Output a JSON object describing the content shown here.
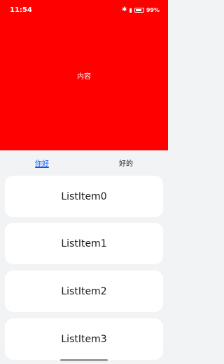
{
  "status_bar": {
    "time": "11:54",
    "battery_text": "99%"
  },
  "content": {
    "label": "内容",
    "background": "#ff0000"
  },
  "tabs": [
    {
      "label": "你好",
      "active": true
    },
    {
      "label": "好的",
      "active": false
    }
  ],
  "accent_color": "#0a59f7",
  "list": {
    "items": [
      "ListItem0",
      "ListItem1",
      "ListItem2",
      "ListItem3"
    ]
  }
}
